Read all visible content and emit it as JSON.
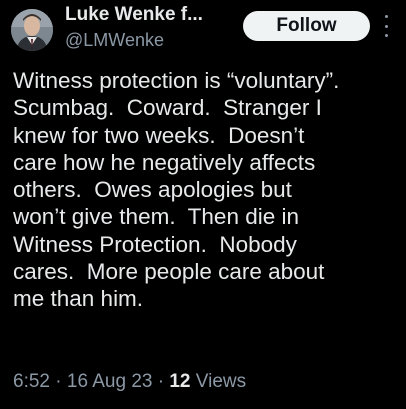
{
  "author": {
    "display_name": "Luke Wenke f...",
    "handle": "@LMWenke",
    "avatar_icon": "profile-photo"
  },
  "follow_label": "Follow",
  "more_icon": "more-vertical-icon",
  "tweet": {
    "text": "Witness protection is “voluntary”.\nScumbag.  Coward.  Stranger I\nknew for two weeks.  Doesn’t\ncare how he negatively affects\nothers.  Owes apologies but\nwon’t give them.  Then die in\nWitness Protection.  Nobody\ncares.  More people care about\nme than him."
  },
  "meta": {
    "time": "6:52",
    "separator": "·",
    "date": "16 Aug 23",
    "views_count": "12",
    "views_label": "Views"
  },
  "colors": {
    "background": "#000000",
    "primary_text": "#e7e9ea",
    "secondary_text": "#8b98a5",
    "follow_button_bg": "#eff3f4",
    "follow_button_text": "#0f1419"
  }
}
